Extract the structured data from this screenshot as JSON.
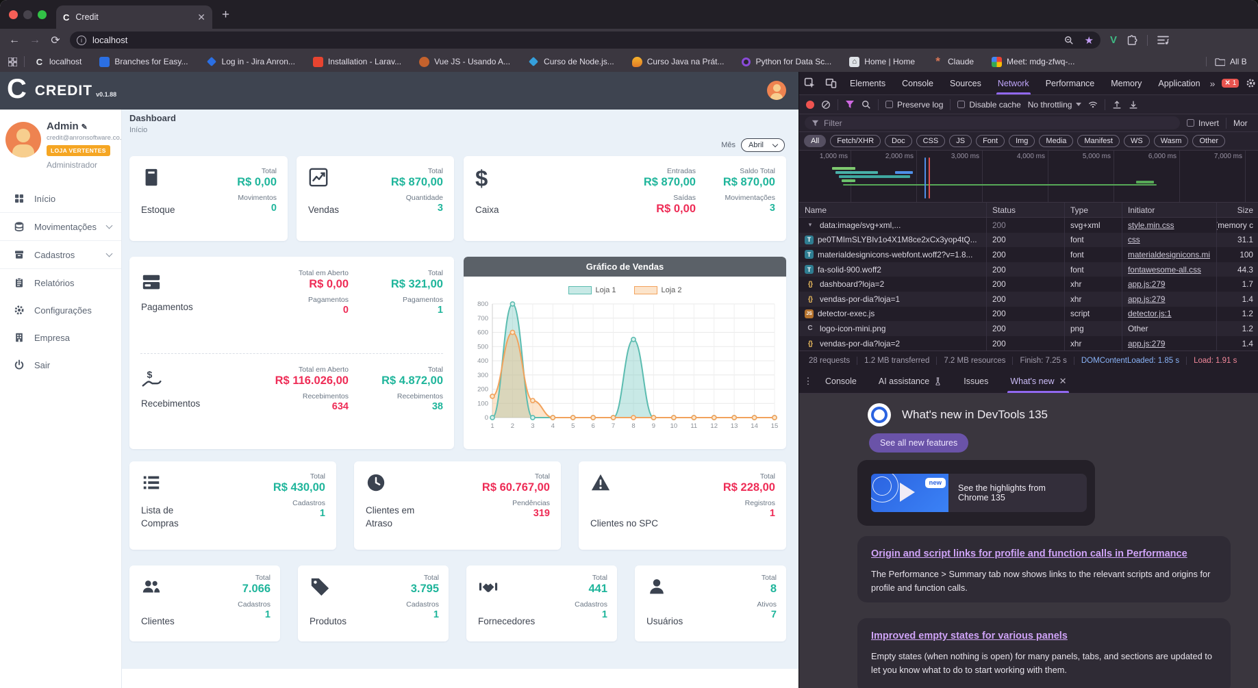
{
  "browser": {
    "tab_title": "Credit",
    "tab_favicon": "C",
    "url": "localhost",
    "bookmarks": [
      {
        "label": "localhost",
        "icon": "c-letter",
        "glyph": "C"
      },
      {
        "label": "Branches for Easy...",
        "icon": "bitbucket",
        "glyph": ""
      },
      {
        "label": "Log in - Jira Anron...",
        "icon": "jira",
        "glyph": ""
      },
      {
        "label": "Installation - Larav...",
        "icon": "laravel",
        "glyph": ""
      },
      {
        "label": "Vue JS - Usando A...",
        "icon": "course",
        "glyph": ""
      },
      {
        "label": "Curso de Node.js...",
        "icon": "node",
        "glyph": ""
      },
      {
        "label": "Curso Java na Prát...",
        "icon": "java",
        "glyph": ""
      },
      {
        "label": "Python for Data Sc...",
        "icon": "python",
        "glyph": ""
      },
      {
        "label": "Home | Home",
        "icon": "home",
        "glyph": "⌂"
      },
      {
        "label": "Claude",
        "icon": "claude",
        "glyph": "*"
      },
      {
        "label": "Meet: mdg-zfwq-...",
        "icon": "meet",
        "glyph": ""
      }
    ],
    "all_bookmarks_label": "All B"
  },
  "app": {
    "header": {
      "logo": "C",
      "brand": "CREDIT",
      "version": "v0.1.88"
    },
    "sidebar": {
      "user": {
        "name": "Admin",
        "email": "credit@anronsoftware.co...",
        "store_badge": "LOJA VERTENTES",
        "role": "Administrador"
      },
      "menu": {
        "inicio": "Início",
        "movimentacoes": "Movimentações",
        "cadastros": "Cadastros",
        "relatorios": "Relatórios",
        "configuracoes": "Configurações",
        "empresa": "Empresa",
        "sair": "Sair"
      }
    },
    "page": {
      "title": "Dashboard",
      "subtitle": "Início",
      "month_label": "Mês",
      "month_value": "Abril"
    },
    "cards": {
      "estoque": {
        "title": "Estoque",
        "total_label": "Total",
        "total": "R$ 0,00",
        "count_label": "Movimentos",
        "count": "0"
      },
      "vendas": {
        "title": "Vendas",
        "total_label": "Total",
        "total": "R$ 870,00",
        "count_label": "Quantidade",
        "count": "3"
      },
      "caixa": {
        "title": "Caixa",
        "entradas_label": "Entradas",
        "entradas": "R$ 870,00",
        "saidas_label": "Saídas",
        "saidas": "R$ 0,00",
        "saldo_label": "Saldo Total",
        "saldo": "R$ 870,00",
        "mov_label": "Movimentações",
        "mov": "3"
      },
      "pagamentos": {
        "title": "Pagamentos",
        "aberto_label": "Total em Aberto",
        "aberto": "R$ 0,00",
        "aberto_count_label": "Pagamentos",
        "aberto_count": "0",
        "total_label": "Total",
        "total": "R$ 321,00",
        "total_count_label": "Pagamentos",
        "total_count": "1"
      },
      "recebimentos": {
        "title": "Recebimentos",
        "aberto_label": "Total em Aberto",
        "aberto": "R$ 116.026,00",
        "aberto_count_label": "Recebimentos",
        "aberto_count": "634",
        "total_label": "Total",
        "total": "R$ 4.872,00",
        "total_count_label": "Recebimentos",
        "total_count": "38"
      },
      "lista_compras": {
        "title": "Lista de Compras",
        "total_label": "Total",
        "total": "R$ 430,00",
        "count_label": "Cadastros",
        "count": "1"
      },
      "clientes_atraso": {
        "title": "Clientes em Atraso",
        "total_label": "Total",
        "total": "R$ 60.767,00",
        "count_label": "Pendências",
        "count": "319"
      },
      "clientes_spc": {
        "title": "Clientes no SPC",
        "total_label": "Total",
        "total": "R$ 228,00",
        "count_label": "Registros",
        "count": "1"
      },
      "clientes": {
        "title": "Clientes",
        "total_label": "Total",
        "total": "7.066",
        "count_label": "Cadastros",
        "count": "1"
      },
      "produtos": {
        "title": "Produtos",
        "total_label": "Total",
        "total": "3.795",
        "count_label": "Cadastros",
        "count": "1"
      },
      "fornecedores": {
        "title": "Fornecedores",
        "total_label": "Total",
        "total": "441",
        "count_label": "Cadastros",
        "count": "1"
      },
      "usuarios": {
        "title": "Usuários",
        "total_label": "Total",
        "total": "8",
        "count_label": "Ativos",
        "count": "7"
      }
    },
    "colors": {
      "positive": "#1fb59b",
      "negative": "#ee2c56",
      "badge_orange": "#f5a623",
      "header_slate": "#3e4450"
    }
  },
  "chart_data": {
    "type": "area",
    "title": "Gráfico de Vendas",
    "x": [
      1,
      2,
      3,
      4,
      5,
      6,
      7,
      8,
      9,
      10,
      11,
      12,
      13,
      14,
      15
    ],
    "series": [
      {
        "name": "Loja 1",
        "color": "#5bbcb0",
        "fill": "rgba(110,198,188,0.38)",
        "marker": "#d8f0ec",
        "values": [
          0,
          800,
          0,
          0,
          0,
          0,
          0,
          550,
          0,
          0,
          0,
          0,
          0,
          0,
          0
        ]
      },
      {
        "name": "Loja 2",
        "color": "#f2a25c",
        "fill": "rgba(246,184,118,0.38)",
        "marker": "#fbe7cb",
        "values": [
          150,
          600,
          120,
          0,
          0,
          0,
          0,
          0,
          0,
          0,
          0,
          0,
          0,
          0,
          0
        ]
      }
    ],
    "xlabel": "",
    "ylabel": "",
    "ylim": [
      0,
      800
    ],
    "ytick": 100,
    "grid": true,
    "legend_position": "top"
  },
  "devtools": {
    "tabs": [
      {
        "label": "Elements"
      },
      {
        "label": "Console"
      },
      {
        "label": "Sources"
      },
      {
        "label": "Network",
        "active": true
      },
      {
        "label": "Performance"
      },
      {
        "label": "Memory"
      },
      {
        "label": "Application"
      }
    ],
    "more_tabs": "»",
    "error_badge": "1",
    "toolbar": {
      "preserve_log": "Preserve log",
      "disable_cache": "Disable cache",
      "throttling": "No throttling"
    },
    "filter": {
      "placeholder": "Filter",
      "invert_label": "Invert",
      "more_label": "Mor"
    },
    "type_pills": [
      {
        "label": "All",
        "active": true
      },
      {
        "label": "Fetch/XHR"
      },
      {
        "label": "Doc"
      },
      {
        "label": "CSS"
      },
      {
        "label": "JS"
      },
      {
        "label": "Font"
      },
      {
        "label": "Img"
      },
      {
        "label": "Media"
      },
      {
        "label": "Manifest"
      },
      {
        "label": "WS"
      },
      {
        "label": "Wasm"
      },
      {
        "label": "Other"
      }
    ],
    "timeline_ticks": [
      "1,000 ms",
      "2,000 ms",
      "3,000 ms",
      "4,000 ms",
      "5,000 ms",
      "6,000 ms",
      "7,000 ms"
    ],
    "table": {
      "headers": [
        "Name",
        "Status",
        "Type",
        "Initiator",
        "Size"
      ],
      "rows": [
        {
          "name": "data:image/svg+xml,...",
          "icon": "chevron",
          "iglyph": "▾",
          "status": "200",
          "status_dim": true,
          "type": "svg+xml",
          "initiator": "style.min.css",
          "initiator_link": true,
          "size": "(memory c"
        },
        {
          "name": "pe0TMImSLYBIv1o4X1M8ce2xCx3yop4tQ...",
          "icon": "font",
          "iglyph": "T",
          "status": "200",
          "type": "font",
          "initiator": "css",
          "initiator_link": true,
          "size": "31.1"
        },
        {
          "name": "materialdesignicons-webfont.woff2?v=1.8...",
          "icon": "font",
          "iglyph": "T",
          "status": "200",
          "type": "font",
          "initiator": "materialdesignicons.mi",
          "initiator_link": true,
          "size": "100"
        },
        {
          "name": "fa-solid-900.woff2",
          "icon": "font",
          "iglyph": "T",
          "status": "200",
          "type": "font",
          "initiator": "fontawesome-all.css",
          "initiator_link": true,
          "size": "44.3"
        },
        {
          "name": "dashboard?loja=2",
          "icon": "xhr",
          "iglyph": "{}",
          "status": "200",
          "type": "xhr",
          "initiator": "app.js:279",
          "initiator_link": true,
          "size": "1.7"
        },
        {
          "name": "vendas-por-dia?loja=1",
          "icon": "xhr",
          "iglyph": "{}",
          "status": "200",
          "type": "xhr",
          "initiator": "app.js:279",
          "initiator_link": true,
          "size": "1.4"
        },
        {
          "name": "detector-exec.js",
          "icon": "script",
          "iglyph": "JS",
          "status": "200",
          "type": "script",
          "initiator": "detector.js:1",
          "initiator_link": true,
          "size": "1.2"
        },
        {
          "name": "logo-icon-mini.png",
          "icon": "image",
          "iglyph": "C",
          "status": "200",
          "type": "png",
          "initiator": "Other",
          "initiator_link": false,
          "size": "1.2"
        },
        {
          "name": "vendas-por-dia?loja=2",
          "icon": "xhr",
          "iglyph": "{}",
          "status": "200",
          "type": "xhr",
          "initiator": "app.js:279",
          "initiator_link": true,
          "size": "1.4"
        }
      ]
    },
    "summary": [
      {
        "text": "28 requests"
      },
      {
        "text": "1.2 MB transferred"
      },
      {
        "text": "7.2 MB resources"
      },
      {
        "text": "Finish: 7.25 s"
      },
      {
        "text": "DOMContentLoaded: 1.85 s",
        "blue": true
      },
      {
        "text": "Load: 1.91 s",
        "red": true
      }
    ],
    "drawer_tabs": [
      {
        "label": "Console"
      },
      {
        "label": "AI assistance",
        "flask": true
      },
      {
        "label": "Issues"
      },
      {
        "label": "What's new",
        "active": true,
        "closable": true
      }
    ],
    "whats_new": {
      "title": "What's new in DevTools 135",
      "button": "See all new features",
      "highlight_badge": "new",
      "highlight_text": "See the highlights from Chrome 135",
      "features": [
        {
          "title": "Origin and script links for profile and function calls in Performance",
          "body": "The Performance > Summary tab now shows links to the relevant scripts and origins for profile and function calls."
        },
        {
          "title": "Improved empty states for various panels",
          "body": "Empty states (when nothing is open) for many panels, tabs, and sections are updated to let you know what to do to start working with them."
        }
      ]
    }
  }
}
